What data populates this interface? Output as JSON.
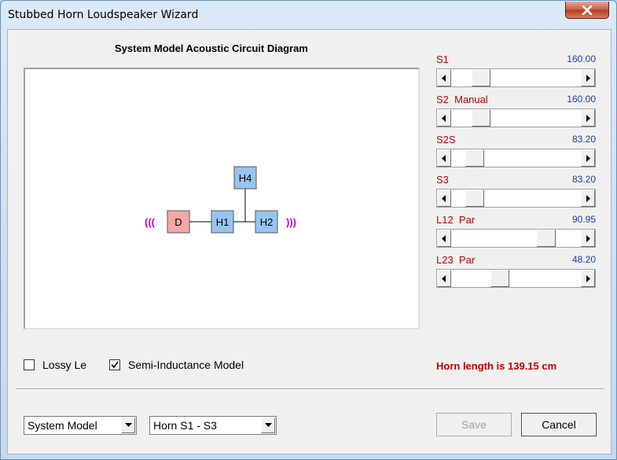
{
  "window": {
    "title": "Stubbed Horn Loudspeaker Wizard"
  },
  "diagram": {
    "title": "System Model Acoustic Circuit Diagram",
    "nodes": {
      "d": "D",
      "h1": "H1",
      "h2": "H2",
      "h4": "H4"
    },
    "left_wave": "(((",
    "right_wave": ")))",
    "colors": {
      "driver_fill": "#f4a7a7",
      "horn_fill": "#98c4f0",
      "wave": "#cc00cc"
    }
  },
  "sliders": [
    {
      "label": "S1",
      "value": "160.00",
      "position": 0.09
    },
    {
      "label": "S2  Manual",
      "value": "160.00",
      "position": 0.09
    },
    {
      "label": "S2S",
      "value": "83.20",
      "position": 0.04
    },
    {
      "label": "S3",
      "value": "83.20",
      "position": 0.04
    },
    {
      "label": "L12  Par",
      "value": "90.95",
      "position": 0.62
    },
    {
      "label": "L23  Par",
      "value": "48.20",
      "position": 0.24
    }
  ],
  "options": {
    "lossy_le": {
      "label": "Lossy Le",
      "checked": false
    },
    "semi_inductance": {
      "label": "Semi-Inductance Model",
      "checked": true
    }
  },
  "status": {
    "horn_length": "Horn length is 139.15 cm"
  },
  "footer": {
    "model_select": "System Model",
    "horn_select": "Horn S1 - S3",
    "save_label": "Save",
    "cancel_label": "Cancel"
  }
}
